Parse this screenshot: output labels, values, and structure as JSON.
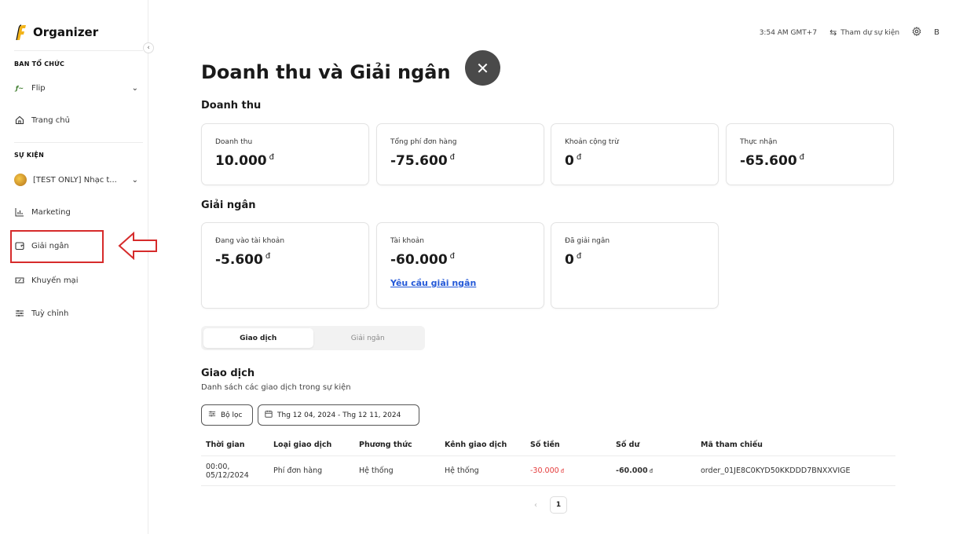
{
  "sidebar": {
    "logo": "Organizer",
    "org_section": "BAN TỔ CHỨC",
    "org_name": "Flip",
    "home": "Trang chủ",
    "event_section": "SỰ KIỆN",
    "event_name": "[TEST ONLY] Nhạc t...",
    "items": [
      {
        "label": "Marketing",
        "icon": "chart-icon"
      },
      {
        "label": "Giải ngân",
        "icon": "wallet-icon"
      },
      {
        "label": "Khuyến mại",
        "icon": "ticket-icon"
      },
      {
        "label": "Tuỳ chỉnh",
        "icon": "sliders-icon"
      }
    ]
  },
  "topbar": {
    "time": "3:54 AM GMT+7",
    "attend": "Tham dự sự kiện",
    "user_initial": "B"
  },
  "page": {
    "title": "Doanh thu và Giải ngân",
    "revenue_heading": "Doanh thu",
    "revenue_cards": [
      {
        "label": "Doanh thu",
        "value": "10.000",
        "currency": "đ"
      },
      {
        "label": "Tổng phí đơn hàng",
        "value": "-75.600",
        "currency": "đ"
      },
      {
        "label": "Khoản cộng trừ",
        "value": "0",
        "currency": "đ"
      },
      {
        "label": "Thực nhận",
        "value": "-65.600",
        "currency": "đ"
      }
    ],
    "payout_heading": "Giải ngân",
    "payout_cards": [
      {
        "label": "Đang vào tài khoản",
        "value": "-5.600",
        "currency": "đ"
      },
      {
        "label": "Tài khoản",
        "value": "-60.000",
        "currency": "đ",
        "link": "Yêu cầu giải ngân"
      },
      {
        "label": "Đã giải ngân",
        "value": "0",
        "currency": "đ"
      }
    ],
    "tabs": [
      "Giao dịch",
      "Giải ngân"
    ],
    "active_tab": "Giao dịch",
    "tx_heading": "Giao dịch",
    "tx_subtitle": "Danh sách các giao dịch trong sự kiện",
    "filter_label": "Bộ lọc",
    "date_range": "Thg 12 04, 2024 - Thg 12 11, 2024"
  },
  "table": {
    "columns": [
      "Thời gian",
      "Loại giao dịch",
      "Phương thức",
      "Kênh giao dịch",
      "Số tiền",
      "Số dư",
      "Mã tham chiếu"
    ],
    "rows": [
      {
        "time_line1": "00:00,",
        "time_line2": "05/12/2024",
        "type": "Phí đơn hàng",
        "method": "Hệ thống",
        "channel": "Hệ thống",
        "amount": "-30.000",
        "balance": "-60.000",
        "currency": "đ",
        "reference": "order_01JE8C0KYD50KKDDD7BNXXVIGE"
      }
    ]
  },
  "pagination": {
    "current": "1"
  },
  "colors": {
    "accent_link": "#2459d8",
    "negative": "#e43b3b",
    "highlight": "#d62b2b"
  }
}
